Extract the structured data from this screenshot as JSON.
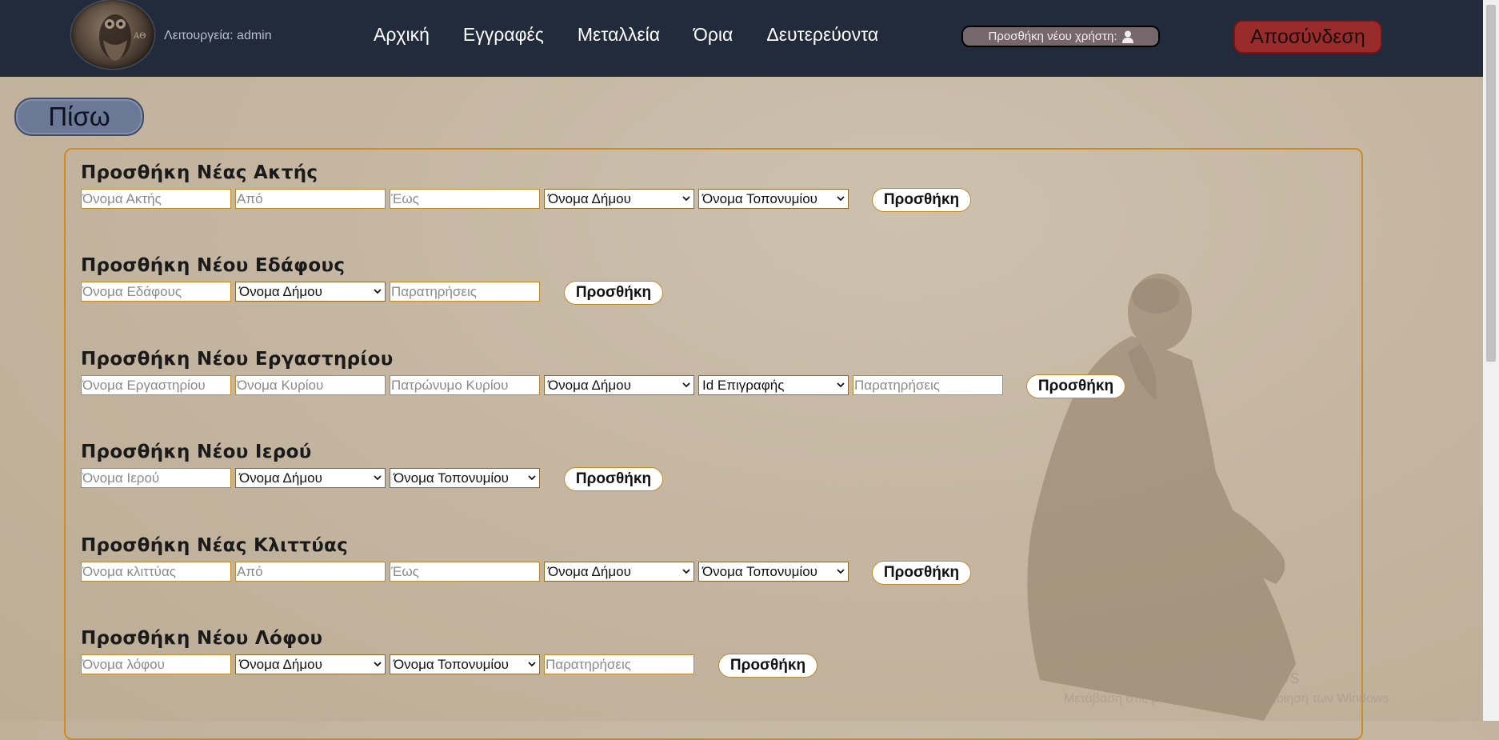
{
  "header": {
    "role_text": "Λειτουργεία: admin",
    "nav": [
      "Αρχική",
      "Εγγραφές",
      "Μεταλλεία",
      "Όρια",
      "Δευτερεύοντα"
    ],
    "add_user_label": "Προσθήκη νέου χρήστη:",
    "logout_label": "Αποσύνδεση"
  },
  "back_label": "Πίσω",
  "add_label": "Προσθήκη",
  "sections": [
    {
      "title": "Προσθήκη Νέας Ακτής",
      "fields": [
        {
          "kind": "input",
          "placeholder": "Όνομα Ακτής"
        },
        {
          "kind": "input",
          "placeholder": "Από"
        },
        {
          "kind": "input",
          "placeholder": "Έως"
        },
        {
          "kind": "select",
          "value": "Όνομα Δήμου"
        },
        {
          "kind": "select",
          "value": "Όνομα Τοπονυμίου"
        }
      ]
    },
    {
      "title": "Προσθήκη Νέου Εδάφους",
      "fields": [
        {
          "kind": "input",
          "placeholder": "Όνομα Εδάφους"
        },
        {
          "kind": "select",
          "value": "Όνομα Δήμου"
        },
        {
          "kind": "input",
          "placeholder": "Παρατηρήσεις"
        }
      ]
    },
    {
      "title": "Προσθήκη Νέου Εργαστηρίου",
      "fields": [
        {
          "kind": "input",
          "placeholder": "Όνομα Εργαστηρίου"
        },
        {
          "kind": "input",
          "placeholder": "Όνομα Κυρίου"
        },
        {
          "kind": "input",
          "placeholder": "Πατρώνυμο Κυρίου"
        },
        {
          "kind": "select",
          "value": "Όνομα Δήμου"
        },
        {
          "kind": "select",
          "value": "Id Επιγραφής"
        },
        {
          "kind": "input",
          "placeholder": "Παρατηρήσεις"
        }
      ]
    },
    {
      "title": "Προσθήκη Νέου Ιερού",
      "fields": [
        {
          "kind": "input",
          "placeholder": "Όνομα Ιερού"
        },
        {
          "kind": "select",
          "value": "Όνομα Δήμου"
        },
        {
          "kind": "select",
          "value": "Όνομα Τοπονυμίου"
        }
      ]
    },
    {
      "title": "Προσθήκη Νέας Κλιττύας",
      "fields": [
        {
          "kind": "input",
          "placeholder": "Όνομα κλιττύας"
        },
        {
          "kind": "input",
          "placeholder": "Από"
        },
        {
          "kind": "input",
          "placeholder": "Έως"
        },
        {
          "kind": "select",
          "value": "Όνομα Δήμου"
        },
        {
          "kind": "select",
          "value": "Όνομα Τοπονυμίου"
        }
      ]
    },
    {
      "title": "Προσθήκη Νέου Λόφου",
      "fields": [
        {
          "kind": "input",
          "placeholder": "Όνομα λόφου"
        },
        {
          "kind": "select",
          "value": "Όνομα Δήμου"
        },
        {
          "kind": "select",
          "value": "Όνομα Τοπονυμίου"
        },
        {
          "kind": "input",
          "placeholder": "Παρατηρήσεις"
        }
      ]
    }
  ],
  "watermark": {
    "line1": "Ενεργοποιήστε τα Windows",
    "line2": "Μετάβαση στις ρυθμίσεις για ενεργοποίηση των Windows."
  },
  "icons": {
    "user": "user-icon",
    "chevron": "chevron-down-icon",
    "logo": "owl-coin-logo"
  }
}
